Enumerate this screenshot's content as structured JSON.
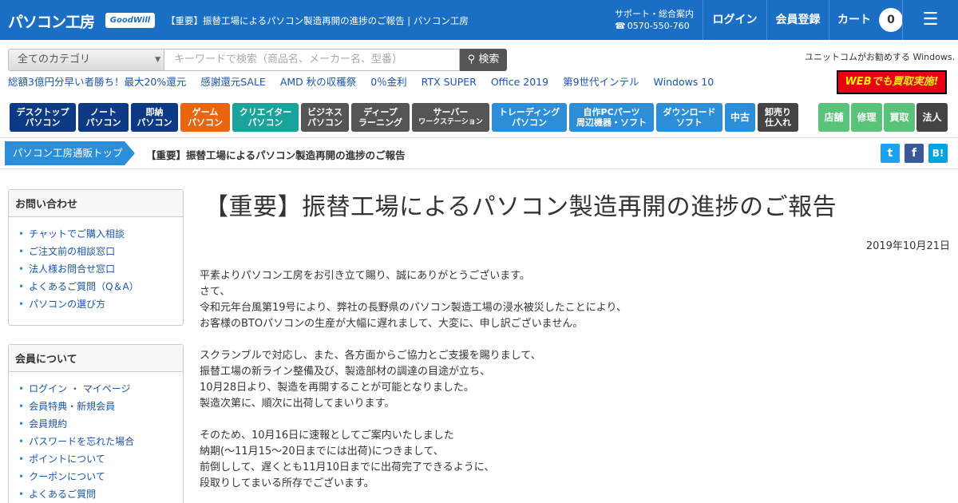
{
  "header": {
    "logo": "パソコン工房",
    "goodwill": "GoodWill",
    "tab_title": "【重要】振替工場によるパソコン製造再開の進捗のご報告 | パソコン工房",
    "support_label": "サポート・総合案内",
    "support_phone": "0570-550-760",
    "login": "ログイン",
    "register": "会員登録",
    "cart": "カート",
    "cart_count": "0",
    "menu_icon": "☰"
  },
  "search": {
    "category": "全てのカテゴリ",
    "placeholder": "キーワードで検索（商品名、メーカー名、型番）",
    "button": "検索",
    "windows_promo": "ユニットコムがお勧めする Windows."
  },
  "promo_links": [
    "総額3億円分早い者勝ち！最大20%還元",
    "感謝還元SALE",
    "AMD 秋の収穫祭",
    "0％金利",
    "RTX SUPER",
    "Office 2019",
    "第9世代インテル",
    "Windows 10"
  ],
  "buyback_badge": "WEBでも買取実施!",
  "category_nav": [
    {
      "l1": "デスクトップ",
      "l2": "パソコン"
    },
    {
      "l1": "ノート",
      "l2": "パソコン"
    },
    {
      "l1": "即納",
      "l2": "パソコン"
    },
    {
      "l1": "ゲーム",
      "l2": "パソコン"
    },
    {
      "l1": "クリエイター",
      "l2": "パソコン"
    },
    {
      "l1": "ビジネス",
      "l2": "パソコン"
    },
    {
      "l1": "ディープ",
      "l2": "ラーニング"
    },
    {
      "l1": "サーバー",
      "l2": "ワークステーション"
    },
    {
      "l1": "トレーディング",
      "l2": "パソコン"
    },
    {
      "l1": "自作PCパーツ",
      "l2": "周辺機器・ソフト"
    },
    {
      "l1": "ダウンロード",
      "l2": "ソフト"
    },
    {
      "l1": "中古"
    },
    {
      "l1": "卸売り",
      "l2": "仕入れ"
    }
  ],
  "service_nav": [
    "店舗",
    "修理",
    "買取",
    "法人"
  ],
  "breadcrumb": {
    "home": "パソコン工房通販トップ",
    "current": "【重要】振替工場によるパソコン製造再開の進捗のご報告"
  },
  "share": {
    "twitter": "t",
    "facebook": "f",
    "hatena": "B!"
  },
  "sidebar": {
    "contact": {
      "title": "お問い合わせ",
      "items": [
        "チャットでご購入相談",
        "ご注文前の相談窓口",
        "法人様お問合せ窓口",
        "よくあるご質問（Q＆A）",
        "パソコンの選び方"
      ]
    },
    "member": {
      "title": "会員について",
      "items": [
        "ログイン ・ マイページ",
        "会員特典・新規会員",
        "会員規約",
        "パスワードを忘れた場合",
        "ポイントについて",
        "クーポンについて",
        "よくあるご質問"
      ]
    }
  },
  "article": {
    "title": "【重要】振替工場によるパソコン製造再開の進捗のご報告",
    "date": "2019年10月21日",
    "paragraphs": [
      [
        "平素よりパソコン工房をお引き立て賜り、誠にありがとうございます。",
        "さて、",
        "令和元年台風第19号により、弊社の長野県のパソコン製造工場の浸水被災したことにより、",
        "お客様のBTOパソコンの生産が大幅に遅れまして、大変に、申し訳ございません。"
      ],
      [
        "スクランブルで対応し、また、各方面からご協力とご支援を賜りまして、",
        "振替工場の新ライン整備及び、製造部材の調達の目途が立ち、",
        "10月28日より、製造を再開することが可能となりました。",
        "製造次第に、順次に出荷してまいります。"
      ],
      [
        "そのため、10月16日に速報としてご案内いたしました",
        "納期(～11月15～20日までには出荷)につきまして、",
        "前倒しして、遅くとも11月10日までに出荷完了できるように、",
        "段取りしてまいる所存でございます。"
      ]
    ]
  }
}
